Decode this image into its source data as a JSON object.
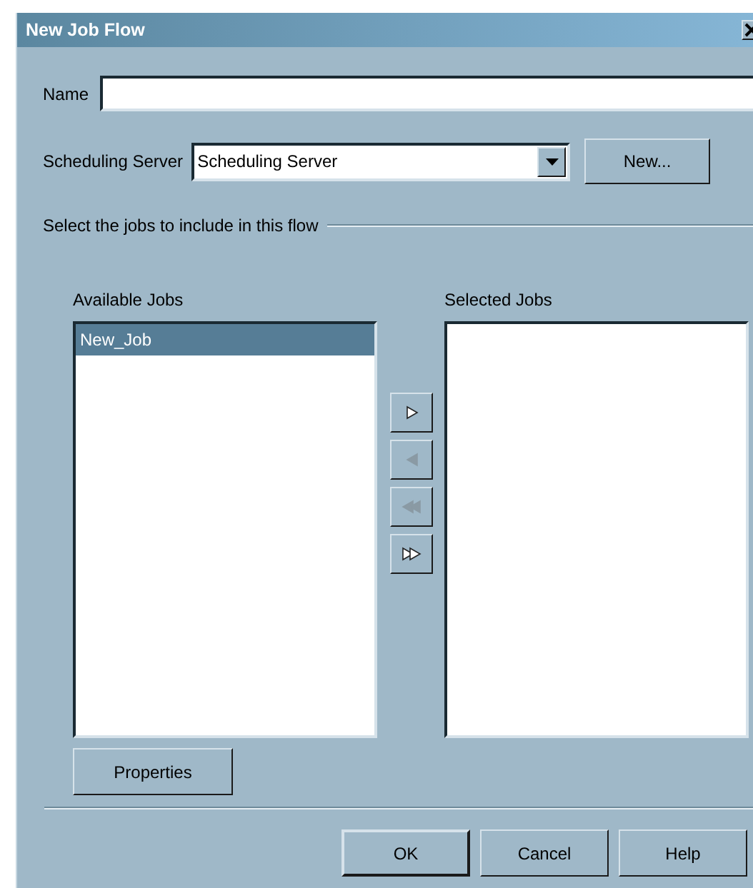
{
  "window": {
    "title": "New Job Flow"
  },
  "name_field": {
    "label": "Name"
  },
  "scheduling_server": {
    "label": "Scheduling Server",
    "value": "Scheduling Server",
    "new_button": "New..."
  },
  "group": {
    "title": "Select the jobs to include in this flow"
  },
  "available_jobs": {
    "label": "Available Jobs",
    "items": [
      {
        "text": "New_Job",
        "selected": true
      }
    ]
  },
  "transfer_buttons": [
    {
      "kind": "add",
      "disabled": false
    },
    {
      "kind": "remove",
      "disabled": true
    },
    {
      "kind": "remove_all",
      "disabled": true
    },
    {
      "kind": "add_all",
      "disabled": false
    }
  ],
  "selected_jobs": {
    "label": "Selected Jobs"
  },
  "properties_button": "Properties",
  "buttons": [
    {
      "label": "OK",
      "default": true
    },
    {
      "label": "Cancel",
      "default": false
    },
    {
      "label": "Help",
      "default": false
    }
  ]
}
